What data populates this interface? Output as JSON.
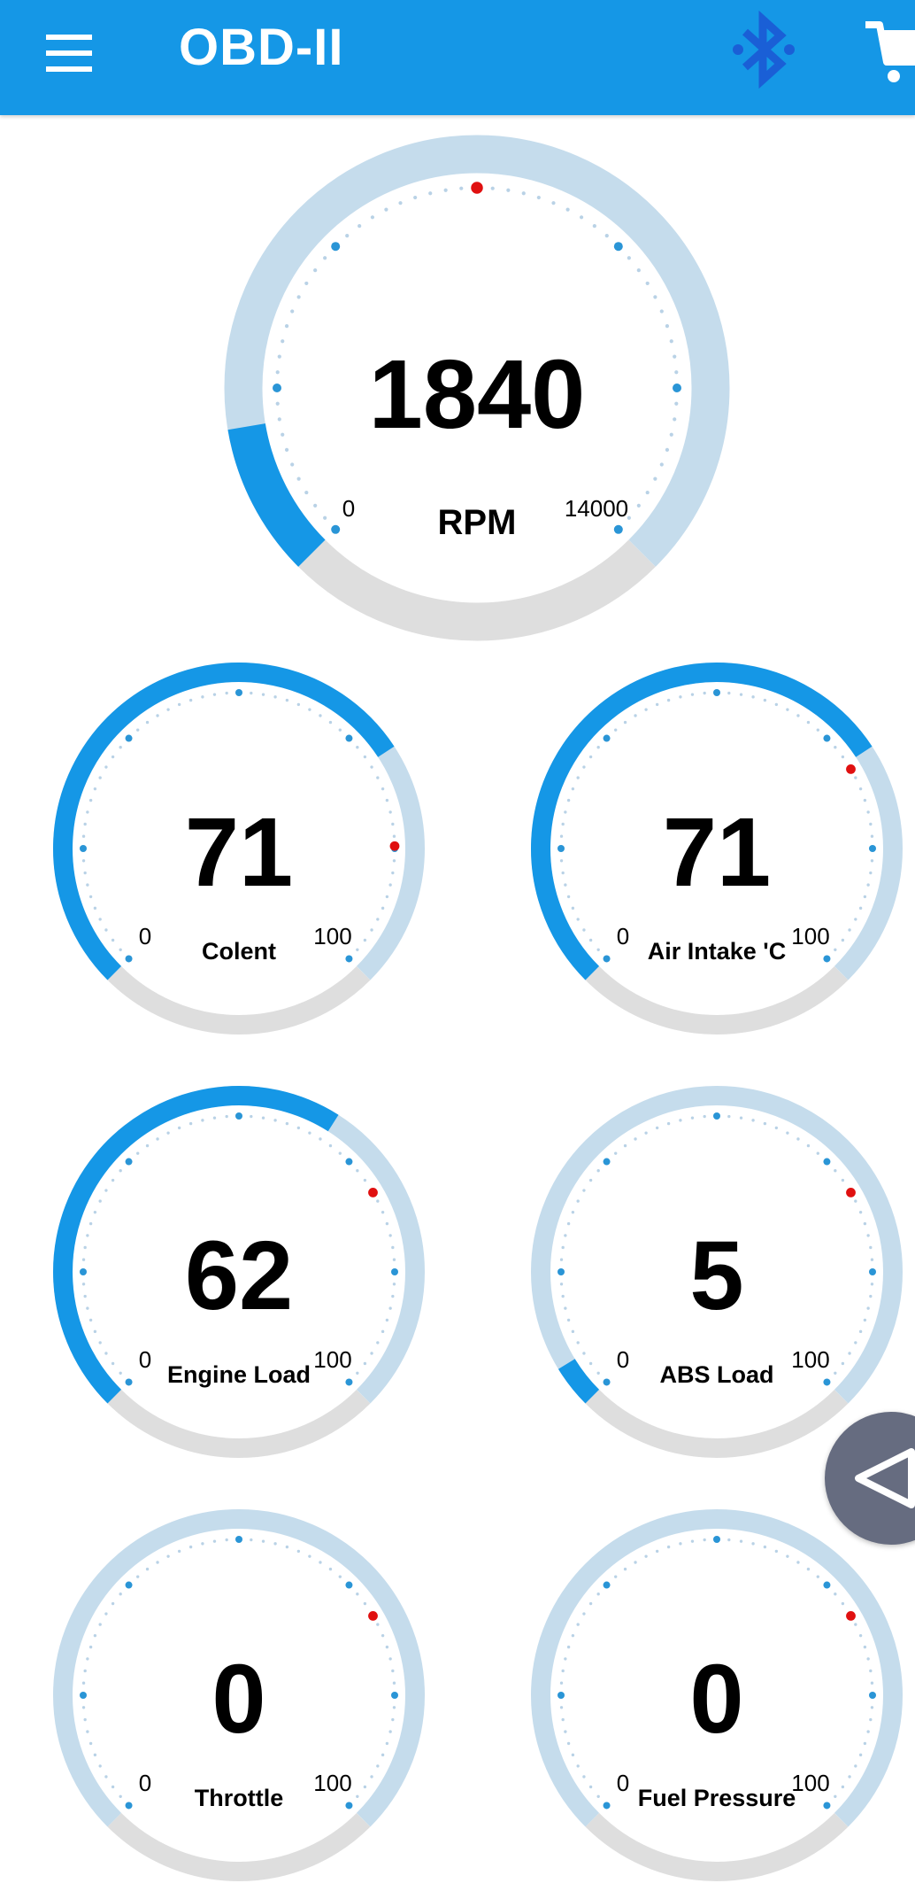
{
  "app": {
    "title": "OBD-II",
    "icons": {
      "menu": "menu-icon",
      "bluetooth": "bluetooth-icon",
      "cart": "cart-icon",
      "collapse": "triangle-left-icon"
    }
  },
  "colors": {
    "appbar": "#1597e6",
    "gauge_fill": "#1597e6",
    "gauge_track": "#c5dcec",
    "gauge_bottom": "#dedede",
    "tick_major": "#2a95d6",
    "tick_minor": "#b9d2e6",
    "alarm_dot": "#e01010",
    "fab": "#666c80",
    "bluetooth": "#1a5fd6"
  },
  "gauges": [
    {
      "id": "rpm",
      "value": "1840",
      "label": "RPM",
      "min": "0",
      "max": "14000",
      "level": 0.1314,
      "alarm_fraction": 0.5
    },
    {
      "id": "coolant",
      "value": "71",
      "label": "Colent",
      "min": "0",
      "max": "100",
      "level": 0.71,
      "alarm_fraction": 0.83
    },
    {
      "id": "air_intake",
      "value": "71",
      "label": "Air Intake 'C",
      "min": "0",
      "max": "100",
      "level": 0.71,
      "alarm_fraction": 0.72
    },
    {
      "id": "engine_load",
      "value": "62",
      "label": "Engine Load",
      "min": "0",
      "max": "100",
      "level": 0.62,
      "alarm_fraction": 0.72
    },
    {
      "id": "abs_load",
      "value": "5",
      "label": "ABS Load",
      "min": "0",
      "max": "100",
      "level": 0.05,
      "alarm_fraction": 0.72
    },
    {
      "id": "throttle",
      "value": "0",
      "label": "Throttle",
      "min": "0",
      "max": "100",
      "level": 0.0,
      "alarm_fraction": 0.72
    },
    {
      "id": "fuel_pressure",
      "value": "0",
      "label": "Fuel Pressure",
      "min": "0",
      "max": "100",
      "level": 0.0,
      "alarm_fraction": 0.72
    }
  ]
}
